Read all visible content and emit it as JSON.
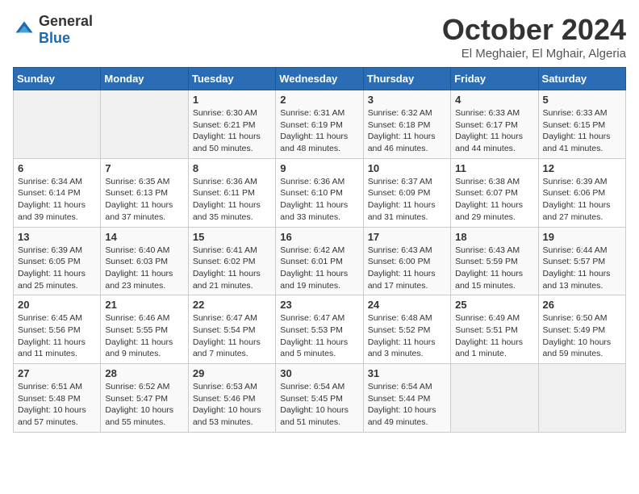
{
  "logo": {
    "general": "General",
    "blue": "Blue"
  },
  "title": {
    "month": "October 2024",
    "location": "El Meghaier, El Mghair, Algeria"
  },
  "weekdays": [
    "Sunday",
    "Monday",
    "Tuesday",
    "Wednesday",
    "Thursday",
    "Friday",
    "Saturday"
  ],
  "weeks": [
    [
      {
        "day": "",
        "empty": true
      },
      {
        "day": "",
        "empty": true
      },
      {
        "day": "1",
        "sunrise": "6:30 AM",
        "sunset": "6:21 PM",
        "daylight": "11 hours and 50 minutes."
      },
      {
        "day": "2",
        "sunrise": "6:31 AM",
        "sunset": "6:19 PM",
        "daylight": "11 hours and 48 minutes."
      },
      {
        "day": "3",
        "sunrise": "6:32 AM",
        "sunset": "6:18 PM",
        "daylight": "11 hours and 46 minutes."
      },
      {
        "day": "4",
        "sunrise": "6:33 AM",
        "sunset": "6:17 PM",
        "daylight": "11 hours and 44 minutes."
      },
      {
        "day": "5",
        "sunrise": "6:33 AM",
        "sunset": "6:15 PM",
        "daylight": "11 hours and 41 minutes."
      }
    ],
    [
      {
        "day": "6",
        "sunrise": "6:34 AM",
        "sunset": "6:14 PM",
        "daylight": "11 hours and 39 minutes."
      },
      {
        "day": "7",
        "sunrise": "6:35 AM",
        "sunset": "6:13 PM",
        "daylight": "11 hours and 37 minutes."
      },
      {
        "day": "8",
        "sunrise": "6:36 AM",
        "sunset": "6:11 PM",
        "daylight": "11 hours and 35 minutes."
      },
      {
        "day": "9",
        "sunrise": "6:36 AM",
        "sunset": "6:10 PM",
        "daylight": "11 hours and 33 minutes."
      },
      {
        "day": "10",
        "sunrise": "6:37 AM",
        "sunset": "6:09 PM",
        "daylight": "11 hours and 31 minutes."
      },
      {
        "day": "11",
        "sunrise": "6:38 AM",
        "sunset": "6:07 PM",
        "daylight": "11 hours and 29 minutes."
      },
      {
        "day": "12",
        "sunrise": "6:39 AM",
        "sunset": "6:06 PM",
        "daylight": "11 hours and 27 minutes."
      }
    ],
    [
      {
        "day": "13",
        "sunrise": "6:39 AM",
        "sunset": "6:05 PM",
        "daylight": "11 hours and 25 minutes."
      },
      {
        "day": "14",
        "sunrise": "6:40 AM",
        "sunset": "6:03 PM",
        "daylight": "11 hours and 23 minutes."
      },
      {
        "day": "15",
        "sunrise": "6:41 AM",
        "sunset": "6:02 PM",
        "daylight": "11 hours and 21 minutes."
      },
      {
        "day": "16",
        "sunrise": "6:42 AM",
        "sunset": "6:01 PM",
        "daylight": "11 hours and 19 minutes."
      },
      {
        "day": "17",
        "sunrise": "6:43 AM",
        "sunset": "6:00 PM",
        "daylight": "11 hours and 17 minutes."
      },
      {
        "day": "18",
        "sunrise": "6:43 AM",
        "sunset": "5:59 PM",
        "daylight": "11 hours and 15 minutes."
      },
      {
        "day": "19",
        "sunrise": "6:44 AM",
        "sunset": "5:57 PM",
        "daylight": "11 hours and 13 minutes."
      }
    ],
    [
      {
        "day": "20",
        "sunrise": "6:45 AM",
        "sunset": "5:56 PM",
        "daylight": "11 hours and 11 minutes."
      },
      {
        "day": "21",
        "sunrise": "6:46 AM",
        "sunset": "5:55 PM",
        "daylight": "11 hours and 9 minutes."
      },
      {
        "day": "22",
        "sunrise": "6:47 AM",
        "sunset": "5:54 PM",
        "daylight": "11 hours and 7 minutes."
      },
      {
        "day": "23",
        "sunrise": "6:47 AM",
        "sunset": "5:53 PM",
        "daylight": "11 hours and 5 minutes."
      },
      {
        "day": "24",
        "sunrise": "6:48 AM",
        "sunset": "5:52 PM",
        "daylight": "11 hours and 3 minutes."
      },
      {
        "day": "25",
        "sunrise": "6:49 AM",
        "sunset": "5:51 PM",
        "daylight": "11 hours and 1 minute."
      },
      {
        "day": "26",
        "sunrise": "6:50 AM",
        "sunset": "5:49 PM",
        "daylight": "10 hours and 59 minutes."
      }
    ],
    [
      {
        "day": "27",
        "sunrise": "6:51 AM",
        "sunset": "5:48 PM",
        "daylight": "10 hours and 57 minutes."
      },
      {
        "day": "28",
        "sunrise": "6:52 AM",
        "sunset": "5:47 PM",
        "daylight": "10 hours and 55 minutes."
      },
      {
        "day": "29",
        "sunrise": "6:53 AM",
        "sunset": "5:46 PM",
        "daylight": "10 hours and 53 minutes."
      },
      {
        "day": "30",
        "sunrise": "6:54 AM",
        "sunset": "5:45 PM",
        "daylight": "10 hours and 51 minutes."
      },
      {
        "day": "31",
        "sunrise": "6:54 AM",
        "sunset": "5:44 PM",
        "daylight": "10 hours and 49 minutes."
      },
      {
        "day": "",
        "empty": true
      },
      {
        "day": "",
        "empty": true
      }
    ]
  ]
}
